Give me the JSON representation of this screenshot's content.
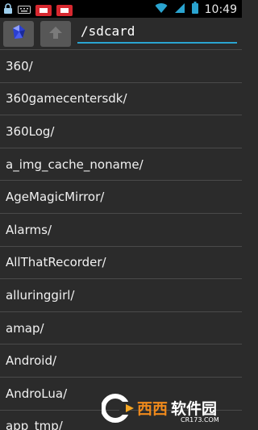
{
  "status_bar": {
    "time": "10:49",
    "icons": [
      "lock-icon",
      "keyboard-icon",
      "notification-red-icon",
      "notification-red-icon",
      "wifi-icon",
      "signal-icon",
      "battery-icon"
    ]
  },
  "toolbar": {
    "path": "/sdcard",
    "app_icon": "gem-icon",
    "up_icon": "up-arrow-icon"
  },
  "files": [
    "360/",
    "360gamecentersdk/",
    "360Log/",
    "a_img_cache_noname/",
    "AgeMagicMirror/",
    "Alarms/",
    "AllThatRecorder/",
    "alluringgirl/",
    "amap/",
    "Android/",
    "AndroLua/",
    "app_tmp/"
  ],
  "watermark": {
    "text_main": "西西软件园",
    "text_sub": "CR173.COM"
  },
  "colors": {
    "background": "#2b2b2b",
    "accent": "#2aa4d0",
    "divider": "#4a4a4a"
  }
}
